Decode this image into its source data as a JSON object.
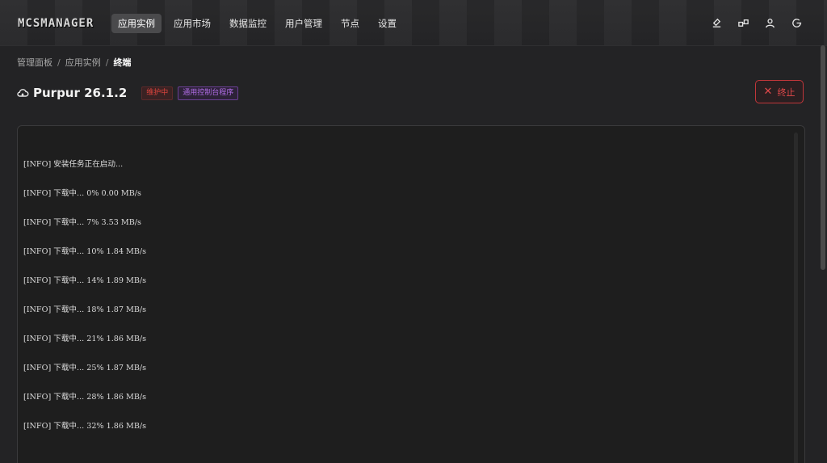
{
  "app": {
    "logo": "MCSMANAGER"
  },
  "nav": {
    "items": [
      {
        "label": "应用实例",
        "active": true
      },
      {
        "label": "应用市场",
        "active": false
      },
      {
        "label": "数据监控",
        "active": false
      },
      {
        "label": "用户管理",
        "active": false
      },
      {
        "label": "节点",
        "active": false
      },
      {
        "label": "设置",
        "active": false
      }
    ],
    "icons": [
      "theme-brush-icon",
      "language-icon",
      "user-icon",
      "logout-icon"
    ]
  },
  "breadcrumb": {
    "items": [
      "管理面板",
      "应用实例",
      "终端"
    ],
    "separator": "/"
  },
  "instance": {
    "name": "Purpur 26.1.2",
    "status_badge": "维护中",
    "type_badge": "通用控制台程序"
  },
  "actions": {
    "stop_label": "终止"
  },
  "terminal": {
    "lines": [
      "[INFO] 安装任务正在启动...",
      "[INFO] 下载中... 0% 0.00 MB/s",
      "[INFO] 下载中... 7% 3.53 MB/s",
      "[INFO] 下载中... 10% 1.84 MB/s",
      "[INFO] 下载中... 14% 1.89 MB/s",
      "[INFO] 下载中... 18% 1.87 MB/s",
      "[INFO] 下载中... 21% 1.86 MB/s",
      "[INFO] 下载中... 25% 1.87 MB/s",
      "[INFO] 下载中... 28% 1.86 MB/s",
      "[INFO] 下载中... 32% 1.86 MB/s"
    ]
  },
  "colors": {
    "background": "#232325",
    "danger": "#e2484a",
    "purple": "#b26ee8",
    "nav_active": "#4a4a4c"
  }
}
